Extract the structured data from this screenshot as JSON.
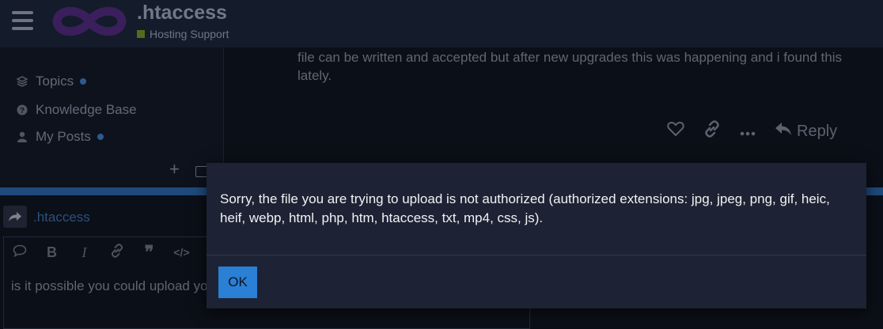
{
  "header": {
    "site_title": ".htaccess",
    "category": "Hosting Support",
    "category_color": "#566b1a"
  },
  "sidebar": {
    "items": [
      {
        "label": "Topics",
        "icon": "layers-icon",
        "unread": true
      },
      {
        "label": "Knowledge Base",
        "icon": "question-circle-icon",
        "unread": false
      },
      {
        "label": "My Posts",
        "icon": "user-icon",
        "unread": true
      }
    ]
  },
  "post": {
    "text": "file can be written and accepted but after new upgrades this was happening and i found this lately.",
    "reply_label": "Reply"
  },
  "composer": {
    "reply_to": ".htaccess",
    "editor_text": "is it possible you could upload yo"
  },
  "modal": {
    "message": "Sorry, the file you are trying to upload is not authorized (authorized extensions: jpg, jpeg, png, gif, heic, heif, webp, html, php, htm, htaccess, txt, mp4, css, js).",
    "ok_label": "OK",
    "accent_color": "#2b7fd5"
  }
}
